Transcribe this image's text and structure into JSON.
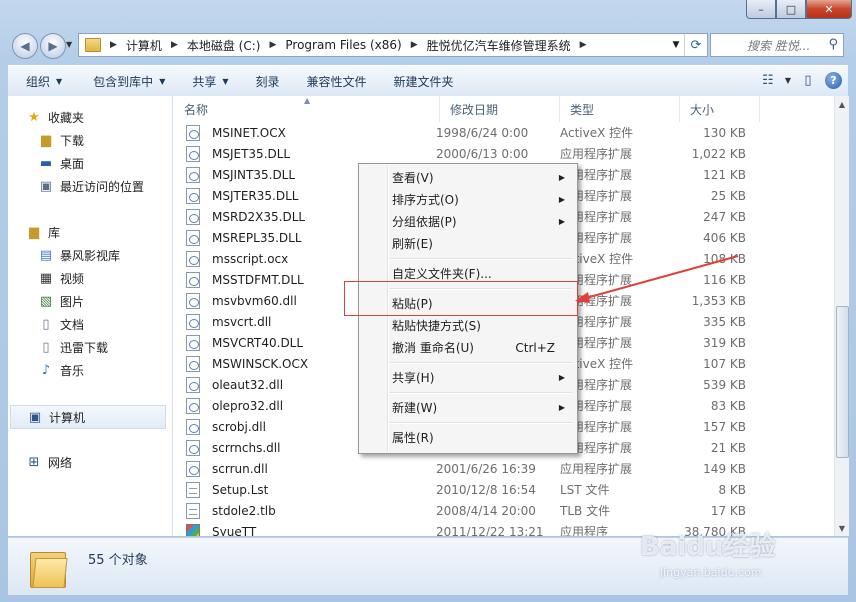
{
  "titlebar": {
    "minimize": "–",
    "maximize": "□",
    "close": "✕"
  },
  "address": {
    "segments": [
      "计算机",
      "本地磁盘 (C:)",
      "Program Files (x86)",
      "胜悦优亿汽车维修管理系统"
    ]
  },
  "search": {
    "placeholder": "搜索 胜悦..."
  },
  "toolbar": {
    "organize": "组织",
    "include": "包含到库中",
    "share": "共享",
    "burn": "刻录",
    "compat": "兼容性文件",
    "new_folder": "新建文件夹"
  },
  "nav": {
    "favorites": "收藏夹",
    "downloads": "下载",
    "desktop": "桌面",
    "recent": "最近访问的位置",
    "libraries": "库",
    "storm": "暴风影视库",
    "videos": "视频",
    "pictures": "图片",
    "documents": "文档",
    "thunder": "迅雷下载",
    "music": "音乐",
    "computer": "计算机",
    "network": "网络"
  },
  "columns": {
    "name": "名称",
    "date": "修改日期",
    "type": "类型",
    "size": "大小"
  },
  "files": [
    {
      "name": "MSINET.OCX",
      "date": "1998/6/24 0:00",
      "type": "ActiveX 控件",
      "size": "130 KB"
    },
    {
      "name": "MSJET35.DLL",
      "date": "2000/6/13 0:00",
      "type": "应用程序扩展",
      "size": "1,022 KB"
    },
    {
      "name": "MSJINT35.DLL",
      "date": "",
      "type": "应用程序扩展",
      "size": "121 KB"
    },
    {
      "name": "MSJTER35.DLL",
      "date": "",
      "type": "应用程序扩展",
      "size": "25 KB"
    },
    {
      "name": "MSRD2X35.DLL",
      "date": "",
      "type": "应用程序扩展",
      "size": "247 KB"
    },
    {
      "name": "MSREPL35.DLL",
      "date": "",
      "type": "应用程序扩展",
      "size": "406 KB"
    },
    {
      "name": "msscript.ocx",
      "date": "",
      "type": "ActiveX 控件",
      "size": "108 KB"
    },
    {
      "name": "MSSTDFMT.DLL",
      "date": "",
      "type": "应用程序扩展",
      "size": "116 KB"
    },
    {
      "name": "msvbvm60.dll",
      "date": "",
      "type": "应用程序扩展",
      "size": "1,353 KB"
    },
    {
      "name": "msvcrt.dll",
      "date": "",
      "type": "应用程序扩展",
      "size": "335 KB"
    },
    {
      "name": "MSVCRT40.DLL",
      "date": "",
      "type": "应用程序扩展",
      "size": "319 KB"
    },
    {
      "name": "MSWINSCK.OCX",
      "date": "",
      "type": "ActiveX 控件",
      "size": "107 KB"
    },
    {
      "name": "oleaut32.dll",
      "date": "",
      "type": "应用程序扩展",
      "size": "539 KB"
    },
    {
      "name": "olepro32.dll",
      "date": "",
      "type": "应用程序扩展",
      "size": "83 KB"
    },
    {
      "name": "scrobj.dll",
      "date": "",
      "type": "应用程序扩展",
      "size": "157 KB"
    },
    {
      "name": "scrrnchs.dll",
      "date": "",
      "type": "应用程序扩展",
      "size": "21 KB"
    },
    {
      "name": "scrrun.dll",
      "date": "2001/6/26 16:39",
      "type": "应用程序扩展",
      "size": "149 KB"
    },
    {
      "name": "Setup.Lst",
      "date": "2010/12/8 16:54",
      "type": "LST 文件",
      "size": "8 KB"
    },
    {
      "name": "stdole2.tlb",
      "date": "2008/4/14 20:00",
      "type": "TLB 文件",
      "size": "17 KB"
    },
    {
      "name": "SyueTT",
      "date": "2011/12/22 13:21",
      "type": "应用程序",
      "size": "38,780 KB"
    }
  ],
  "context_menu": {
    "view": "查看(V)",
    "sort": "排序方式(O)",
    "group": "分组依据(P)",
    "refresh": "刷新(E)",
    "customize": "自定义文件夹(F)...",
    "paste": "粘贴(P)",
    "paste_shortcut": "粘贴快捷方式(S)",
    "undo": "撤消 重命名(U)",
    "undo_shortcut": "Ctrl+Z",
    "share": "共享(H)",
    "new": "新建(W)",
    "properties": "属性(R)"
  },
  "status": {
    "count": "55 个对象"
  },
  "watermark": {
    "logo": "Baidu经验",
    "url": "jingyan.baidu.com"
  },
  "colors": {
    "highlight": "#e0403a",
    "arrow": "#e0403a"
  }
}
